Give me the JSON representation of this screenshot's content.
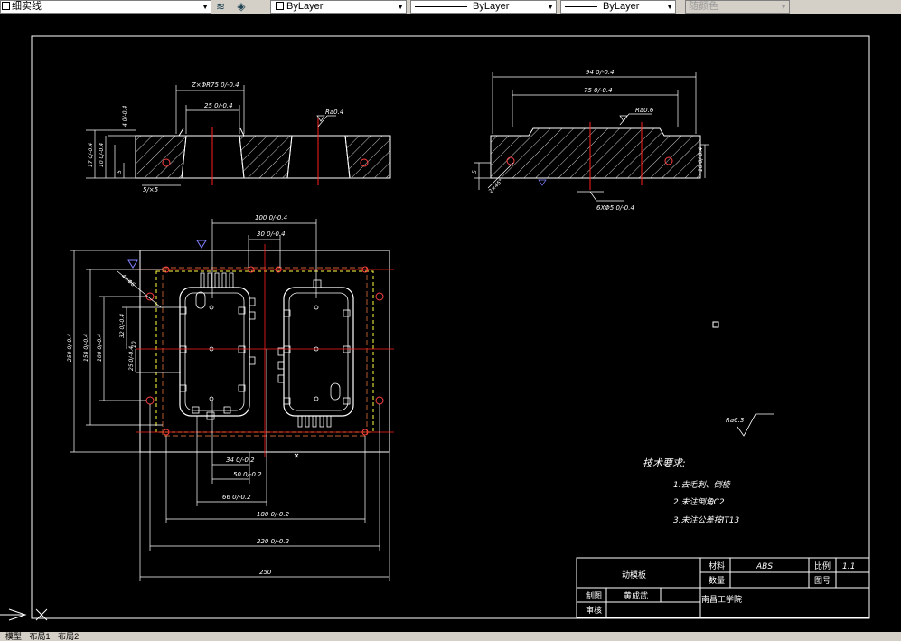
{
  "toolbar": {
    "linetype_combo": "细实线",
    "color_combo": "ByLayer",
    "linetype_combo2": "ByLayer",
    "lineweight_combo": "ByLayer",
    "plotstyle_combo": "随颜色",
    "icons": [
      "layer-states-icon",
      "layer-previous-icon"
    ]
  },
  "drawing": {
    "top_left_view": {
      "dim_overall": "Z×ΦR75 0/-0.4",
      "dim_inner": "25 0/-0.4",
      "roughness": "Ra0.4",
      "dim_chamfer": "5/×5",
      "left_dims": [
        "4 0/-0.4",
        "17 0/-0.4",
        "10 0/-0.4",
        "5"
      ]
    },
    "top_right_view": {
      "dim_overall": "94 0/-0.4",
      "dim_inner": "75 0/-0.4",
      "roughness": "Ra0.6",
      "dim_bottom": "6XΦ5 0/-0.4",
      "dim_left": "5",
      "dim_chamfer": "2×45°",
      "dim_right": "10 0/-0.4"
    },
    "plan_view": {
      "dim_top": "100 0/-0.4",
      "dim_top2": "30 0/-0.4",
      "dim_bottom": [
        "34 0/-0.2",
        "50 0/-0.2",
        "66 0/-0.2",
        "180 0/-0.2",
        "220 0/-0.2",
        "250"
      ],
      "dim_left": [
        "250 0/-0.4",
        "158 0/-0.4",
        "100 0/-0.4",
        "32 0/-0.4",
        "25 0/-0.4",
        "10"
      ],
      "dim_hole": "4×Φ6"
    },
    "roughness_note": "Ra6.3",
    "tech_requirements": {
      "heading": "技术要求:",
      "items": [
        "1.去毛刺、倒棱",
        "2.未注倒角C2",
        "3.未注公差按IT13"
      ]
    },
    "title_block": {
      "part_name": "动模板",
      "material_label": "材料",
      "material_value": "ABS",
      "scale_label": "比例",
      "scale_value": "1:1",
      "qty_label": "数量",
      "drawing_no_label": "图号",
      "designer_label": "制图",
      "designer_name": "黄成武",
      "checker_label": "审核",
      "school": "南昌工学院"
    }
  },
  "tabs": [
    "模型",
    "布局1",
    "布局2"
  ],
  "colors": {
    "background": "#000000",
    "line": "#ffffff",
    "center_line": "#ff2020",
    "hidden_line": "#ffff40",
    "dimension": "#ffffff",
    "toolbar": "#d4d0c8"
  }
}
